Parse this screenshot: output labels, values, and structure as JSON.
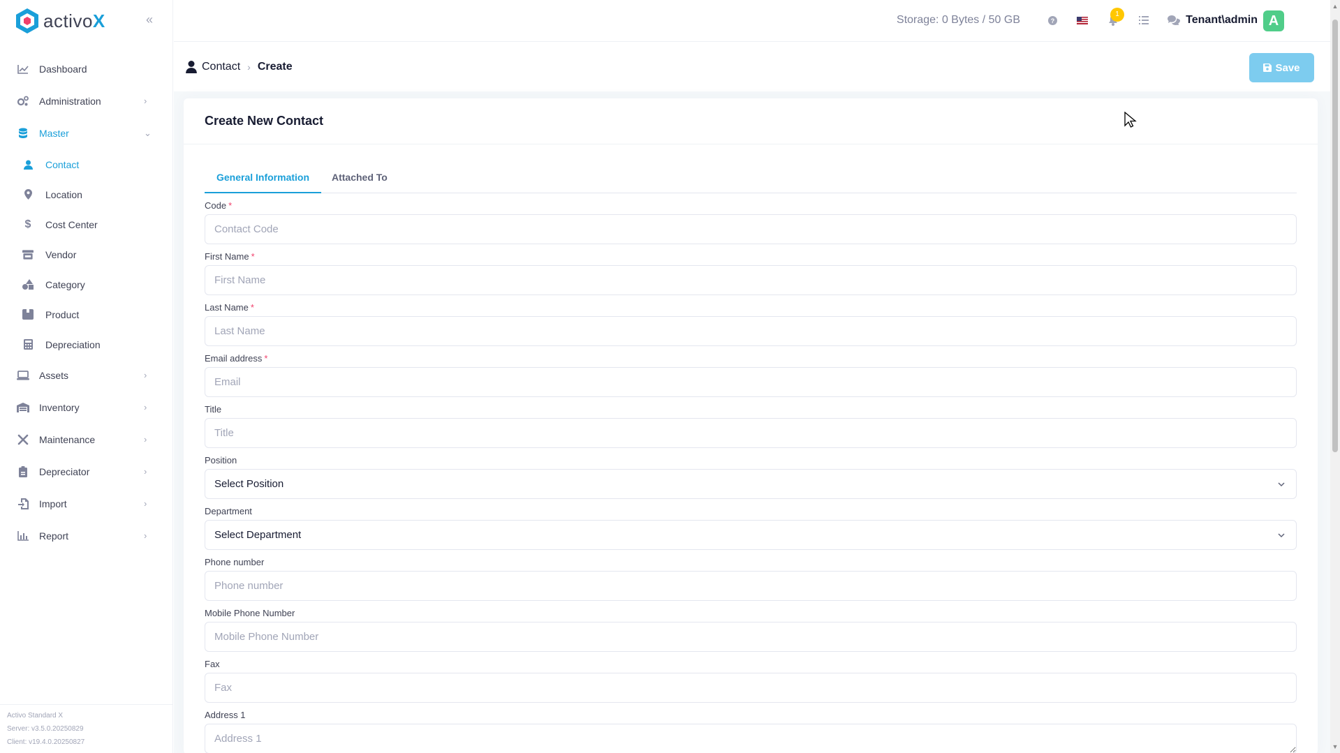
{
  "app": {
    "brand_name": "activo",
    "brand_x": "X",
    "accent": "#1a9fd9"
  },
  "sidebar": {
    "items": [
      {
        "label": "Dashboard",
        "icon": "chart-line-icon"
      },
      {
        "label": "Administration",
        "icon": "gears-icon"
      },
      {
        "label": "Master",
        "icon": "database-icon"
      },
      {
        "label": "Assets",
        "icon": "laptop-icon"
      },
      {
        "label": "Inventory",
        "icon": "warehouse-icon"
      },
      {
        "label": "Maintenance",
        "icon": "tools-icon"
      },
      {
        "label": "Depreciator",
        "icon": "clipboard-icon"
      },
      {
        "label": "Import",
        "icon": "file-import-icon"
      },
      {
        "label": "Report",
        "icon": "chart-bar-icon"
      }
    ],
    "master_sub": [
      {
        "label": "Contact",
        "icon": "user-icon"
      },
      {
        "label": "Location",
        "icon": "map-pin-icon"
      },
      {
        "label": "Cost Center",
        "icon": "dollar-icon"
      },
      {
        "label": "Vendor",
        "icon": "store-icon"
      },
      {
        "label": "Category",
        "icon": "shapes-icon"
      },
      {
        "label": "Product",
        "icon": "box-icon"
      },
      {
        "label": "Depreciation",
        "icon": "calculator-icon"
      }
    ],
    "version": {
      "edition": "Activo Standard X",
      "server": "Server: v3.5.0.20250829",
      "client": "Client: v19.4.0.20250827"
    }
  },
  "header": {
    "storage": "Storage: 0 Bytes / 50 GB",
    "notification_count": "1",
    "tenant_user": "Tenant\\admin",
    "avatar_letter": "A"
  },
  "toolbar": {
    "breadcrumb_root": "Contact",
    "breadcrumb_current": "Create",
    "save_label": "Save"
  },
  "form": {
    "title": "Create New Contact",
    "tabs": [
      "General Information",
      "Attached To"
    ],
    "fields": {
      "code": {
        "label": "Code",
        "placeholder": "Contact Code"
      },
      "first_name": {
        "label": "First Name",
        "placeholder": "First Name"
      },
      "last_name": {
        "label": "Last Name",
        "placeholder": "Last Name"
      },
      "email": {
        "label": "Email address",
        "placeholder": "Email"
      },
      "title": {
        "label": "Title",
        "placeholder": "Title"
      },
      "position": {
        "label": "Position",
        "value": "Select Position"
      },
      "department": {
        "label": "Department",
        "value": "Select Department"
      },
      "phone": {
        "label": "Phone number",
        "placeholder": "Phone number"
      },
      "mobile": {
        "label": "Mobile Phone Number",
        "placeholder": "Mobile Phone Number"
      },
      "fax": {
        "label": "Fax",
        "placeholder": "Fax"
      },
      "address1": {
        "label": "Address 1",
        "placeholder": "Address 1"
      }
    },
    "required_mark": "*"
  }
}
